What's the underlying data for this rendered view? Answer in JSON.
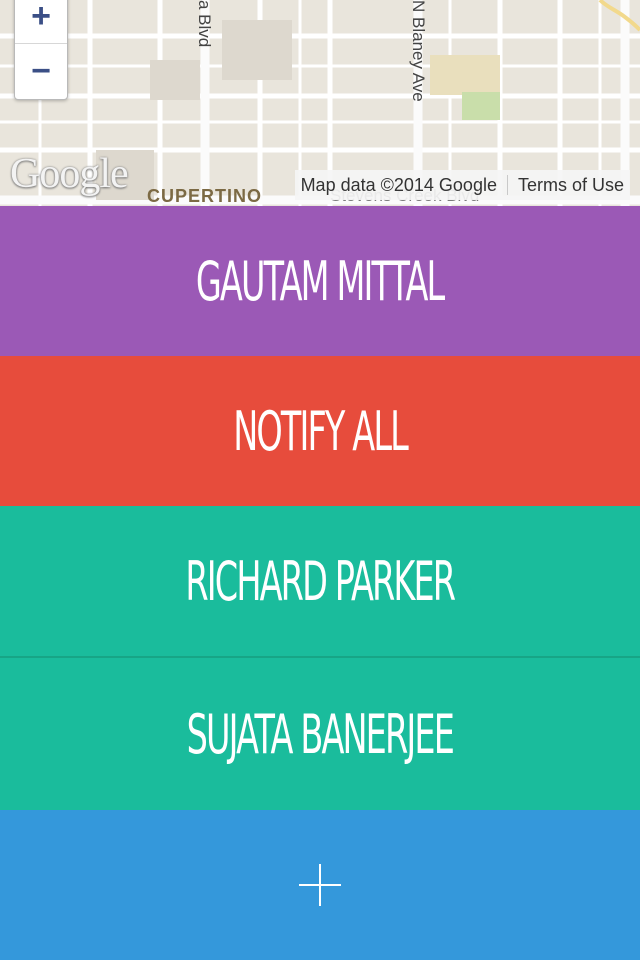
{
  "map": {
    "zoom_in_label": "+",
    "zoom_out_label": "−",
    "logo_text": "Google",
    "attribution": "Map data ©2014 Google",
    "terms": "Terms of Use",
    "place_label": "CUPERTINO",
    "roads": [
      "a Blvd",
      "N Blaney Ave",
      "Stevens Creek Blvd"
    ]
  },
  "contacts": {
    "primary": "GAUTAM MITTAL",
    "notify_all": "NOTIFY ALL",
    "items": [
      "RICHARD PARKER",
      "SUJATA BANERJEE"
    ]
  },
  "add_icon": "plus-icon",
  "colors": {
    "purple": "#9b59b6",
    "red": "#e74c3c",
    "teal": "#1abc9c",
    "blue": "#3498db"
  }
}
